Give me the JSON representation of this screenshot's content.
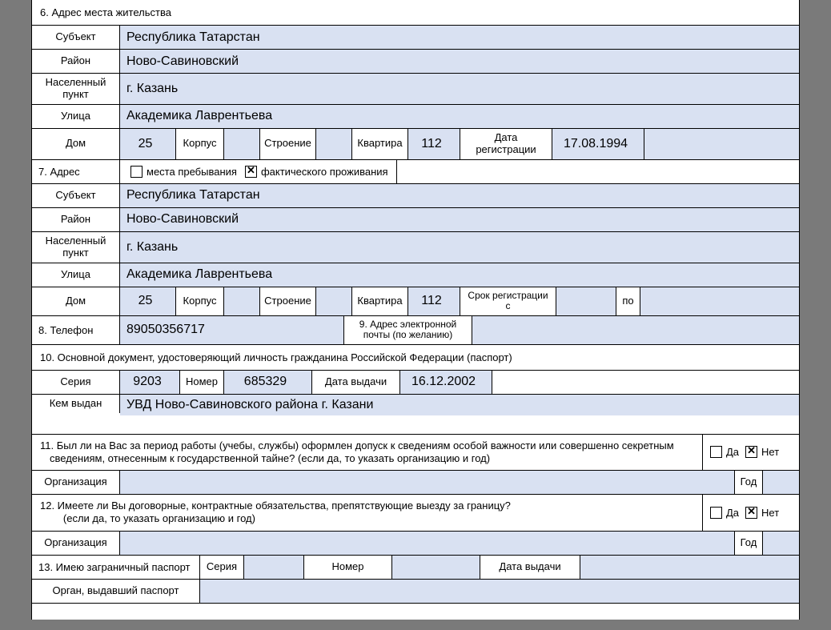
{
  "s6": {
    "title": "6. Адрес места жительства",
    "subjekt_lbl": "Субъект",
    "subjekt": "Республика Татарстан",
    "rajon_lbl": "Район",
    "rajon": "Ново-Савиновский",
    "naspunkt_lbl": "Населенный пункт",
    "naspunkt": "г. Казань",
    "ulitsa_lbl": "Улица",
    "ulitsa": "Академика Лаврентьева",
    "dom_lbl": "Дом",
    "dom": "25",
    "korpus_lbl": "Корпус",
    "korpus": "",
    "stroenie_lbl": "Строение",
    "stroenie": "",
    "kvartira_lbl": "Квартира",
    "kvartira": "112",
    "datareg_lbl": "Дата регистрации",
    "datareg": "17.08.1994"
  },
  "s7": {
    "title": "7. Адрес",
    "opt_preb": "места пребывания",
    "opt_fakt": "фактического проживания",
    "subjekt": "Республика Татарстан",
    "rajon": "Ново-Савиновский",
    "naspunkt": "г. Казань",
    "ulitsa": "Академика Лаврентьева",
    "dom": "25",
    "korpus": "",
    "stroenie": "",
    "kvartira": "112",
    "srok_lbl": "Срок регистрации с",
    "srok_s": "",
    "po_lbl": "по",
    "srok_po": ""
  },
  "s8": {
    "lbl": "8. Телефон",
    "val": "89050356717"
  },
  "s9": {
    "lbl": "9. Адрес электронной почты (по желанию)",
    "val": ""
  },
  "s10": {
    "title": "10. Основной документ, удостоверяющий личность гражданина Российской Федерации (паспорт)",
    "seria_lbl": "Серия",
    "seria": "9203",
    "nomer_lbl": "Номер",
    "nomer": "685329",
    "data_lbl": "Дата выдачи",
    "data": "16.12.2002",
    "kem_lbl": "Кем выдан",
    "kem": "УВД Ново-Савиновского района г. Казани"
  },
  "s11": {
    "text": "11. Был ли на Вас за период работы (учебы, службы) оформлен допуск к сведениям особой важности или совершенно секретным сведениям, отнесенным к государственной тайне? (если да, то указать организацию и год)",
    "da": "Да",
    "net": "Нет",
    "org_lbl": "Организация",
    "org": "",
    "god_lbl": "Год",
    "god": ""
  },
  "s12": {
    "text": "12. Имеете ли Вы договорные, контрактные обязательства, препятствующие выезду за границу?\n        (если да, то указать организацию и год)",
    "da": "Да",
    "net": "Нет",
    "org_lbl": "Организация",
    "org": "",
    "god_lbl": "Год",
    "god": ""
  },
  "s13": {
    "title": "13. Имею заграничный паспорт",
    "seria_lbl": "Серия",
    "seria": "",
    "nomer_lbl": "Номер",
    "nomer": "",
    "data_lbl": "Дата выдачи",
    "data": "",
    "organ_lbl": "Орган, выдавший паспорт",
    "organ": ""
  }
}
